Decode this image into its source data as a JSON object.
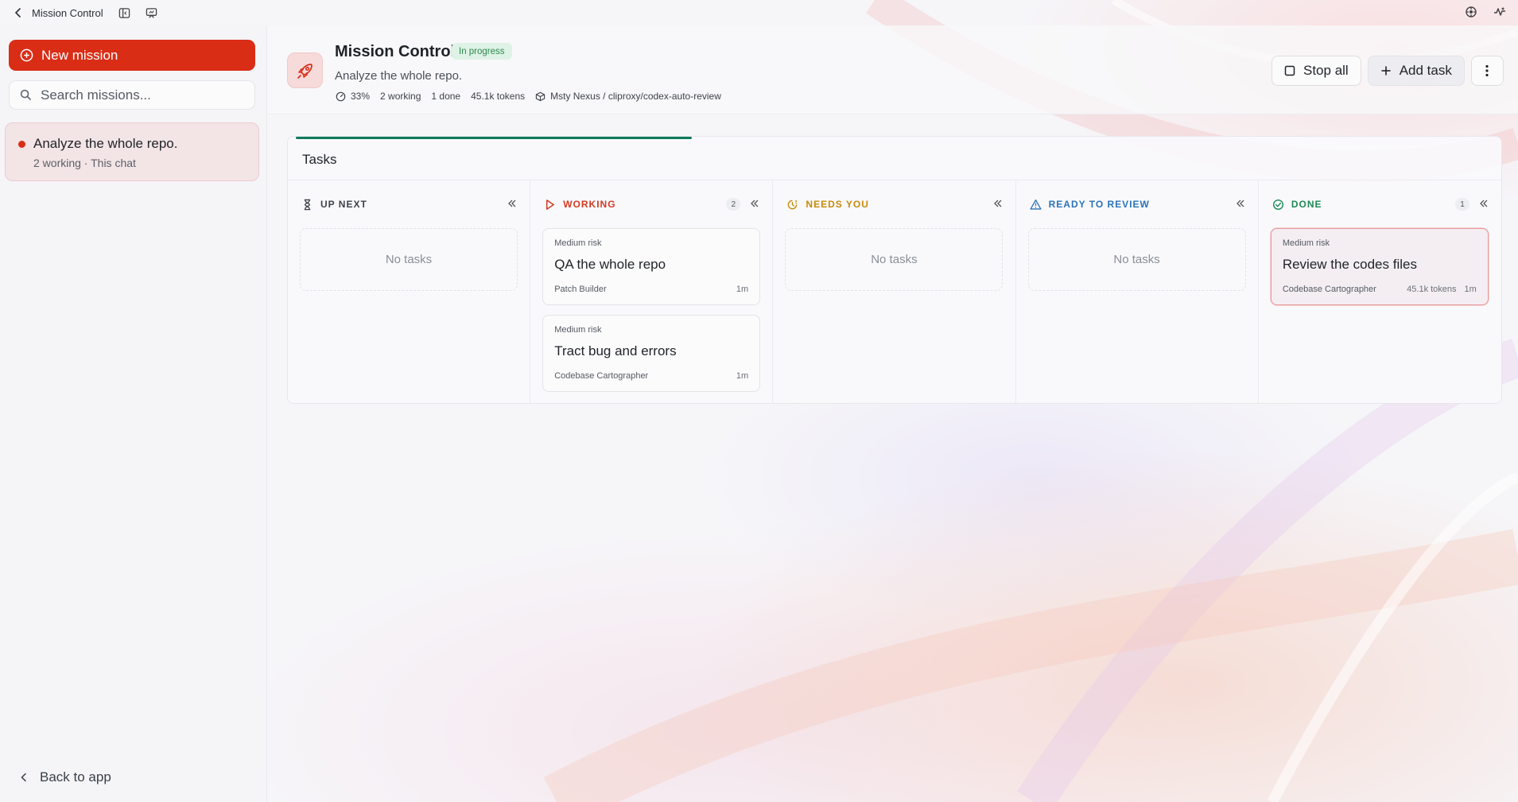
{
  "titlebar": {
    "title": "Mission Control"
  },
  "sidebar": {
    "new_mission_label": "New mission",
    "search_placeholder": "Search missions...",
    "missions": [
      {
        "title": "Analyze the whole repo.",
        "subtitle": "2 working · This chat"
      }
    ],
    "back_label": "Back to app"
  },
  "header": {
    "title": "Mission Control",
    "status": "In progress",
    "description": "Analyze the whole repo.",
    "stats": {
      "progress": "33%",
      "working": "2 working",
      "done": "1 done",
      "tokens": "45.1k tokens",
      "model": "Msty Nexus / cliproxy/codex-auto-review"
    },
    "actions": {
      "stop_all": "Stop all",
      "add_task": "Add task"
    }
  },
  "board": {
    "title": "Tasks",
    "progress_fraction": 0.33,
    "columns": [
      {
        "label": "UP NEXT",
        "color": "#3d424a",
        "empty": "No tasks",
        "count": "",
        "tasks": []
      },
      {
        "label": "WORKING",
        "color": "#d23a23",
        "count": "2",
        "tasks": [
          {
            "risk": "Medium risk",
            "title": "QA the whole repo",
            "agent": "Patch Builder",
            "tokens": "",
            "time": "1m"
          },
          {
            "risk": "Medium risk",
            "title": "Tract bug and errors",
            "agent": "Codebase Cartographer",
            "tokens": "",
            "time": "1m"
          }
        ]
      },
      {
        "label": "NEEDS YOU",
        "color": "#c88a0c",
        "empty": "No tasks",
        "count": "",
        "tasks": []
      },
      {
        "label": "READY TO REVIEW",
        "color": "#2a73b8",
        "empty": "No tasks",
        "count": "",
        "tasks": []
      },
      {
        "label": "DONE",
        "color": "#1f8a55",
        "count": "1",
        "tasks": [
          {
            "risk": "Medium risk",
            "title": "Review the codes files",
            "agent": "Codebase Cartographer",
            "tokens": "45.1k tokens",
            "time": "1m"
          }
        ]
      }
    ]
  }
}
